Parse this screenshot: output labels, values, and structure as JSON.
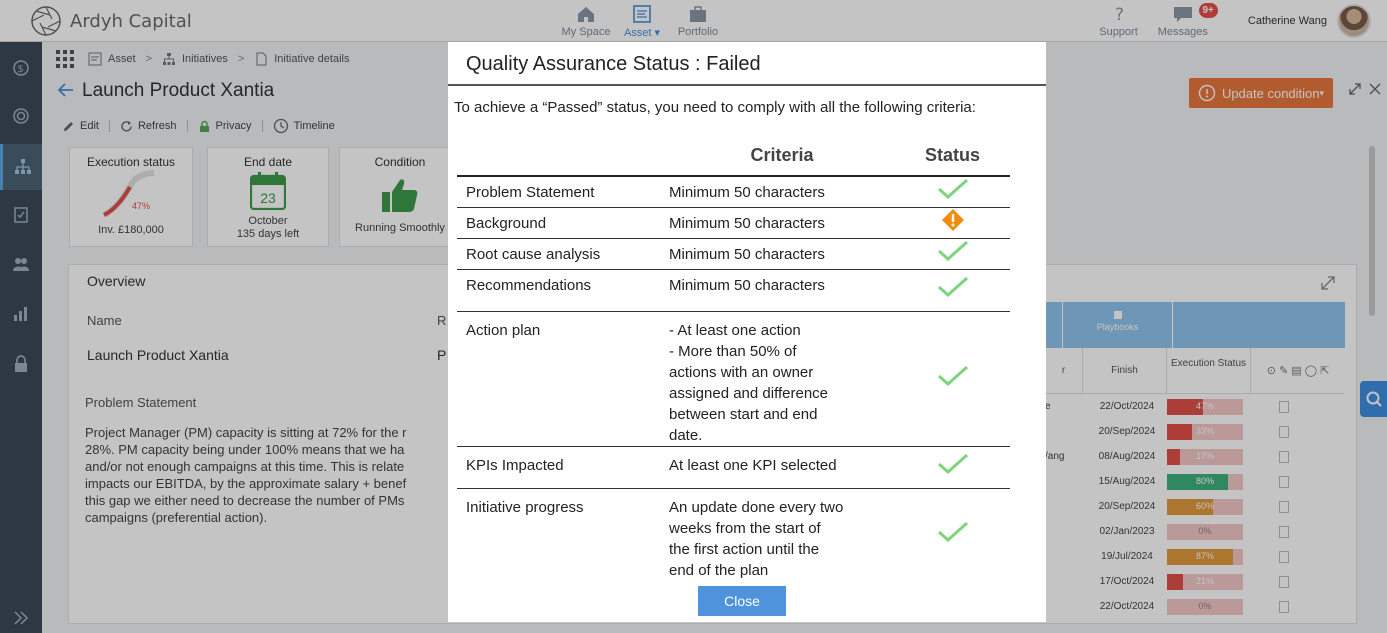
{
  "app": {
    "name": "Ardyh Capital",
    "nav": [
      {
        "label": "My Space",
        "icon": "home-icon"
      },
      {
        "label": "Asset",
        "icon": "asset-icon",
        "active": true
      },
      {
        "label": "Portfolio",
        "icon": "briefcase-icon"
      }
    ],
    "support_label": "Support",
    "messages_label": "Messages",
    "messages_badge": "9+",
    "user_name": "Catherine Wang"
  },
  "breadcrumb": [
    "Asset",
    "Initiatives",
    "Initiative details"
  ],
  "page": {
    "title": "Launch Product Xantia",
    "toolbar": {
      "edit": "Edit",
      "refresh": "Refresh",
      "privacy": "Privacy",
      "timeline": "Timeline"
    },
    "update_condition": "Update condition"
  },
  "kpis": {
    "execution": {
      "title": "Execution status",
      "pct": "47%",
      "sub": "Inv. £180,000"
    },
    "end_date": {
      "title": "End date",
      "day": "23",
      "month": "October",
      "sub": "135 days left"
    },
    "condition": {
      "title": "Condition",
      "sub": "Running Smoothly"
    }
  },
  "overview": {
    "title": "Overview",
    "name_label": "Name",
    "name_value": "Launch Product Xantia",
    "r_label": "R",
    "p_value": "P",
    "problem_title": "Problem Statement",
    "problem_body": "Project Manager (PM) capacity is sitting at 72% for the r\n28%. PM capacity being under 100% means that we ha\nand/or not enough campaigns at this time. This is relate\nimpacts our EBITDA, by the approximate salary + benef\nthis gap we either need to decrease the number of PMs\ncampaigns (preferential action)."
  },
  "side_table": {
    "header_label": "Playbooks",
    "col_finish": "Finish",
    "col_exec": "Execution Status",
    "col_r": "r",
    "rows": [
      {
        "c1": "e",
        "finish": "22/Oct/2024",
        "pct": "47%",
        "value": 0.47,
        "color": "#e0504a"
      },
      {
        "c1": "",
        "finish": "20/Sep/2024",
        "pct": "33%",
        "value": 0.33,
        "color": "#e0504a"
      },
      {
        "c1": "/ang",
        "finish": "08/Aug/2024",
        "pct": "17%",
        "value": 0.17,
        "color": "#e0504a"
      },
      {
        "c1": "",
        "finish": "15/Aug/2024",
        "pct": "80%",
        "value": 0.8,
        "color": "#3fb27f"
      },
      {
        "c1": "",
        "finish": "20/Sep/2024",
        "pct": "60%",
        "value": 0.6,
        "color": "#e09a3e"
      },
      {
        "c1": "",
        "finish": "02/Jan/2023",
        "pct": "0%",
        "value": 0.0,
        "color": "#e0504a"
      },
      {
        "c1": "",
        "finish": "19/Jul/2024",
        "pct": "87%",
        "value": 0.87,
        "color": "#e09a3e"
      },
      {
        "c1": "",
        "finish": "17/Oct/2024",
        "pct": "21%",
        "value": 0.21,
        "color": "#e0504a"
      },
      {
        "c1": "",
        "finish": "22/Oct/2024",
        "pct": "0%",
        "value": 0.0,
        "color": "#e0504a"
      }
    ]
  },
  "modal": {
    "title": "Quality Assurance Status : Failed",
    "intro": "To achieve a  “Passed” status,   you need to comply with all the following criteria:",
    "col_criteria": "Criteria",
    "col_status": "Status",
    "rows": [
      {
        "name": "Problem Statement",
        "criteria": "Minimum 50 characters",
        "status": "passed"
      },
      {
        "name": "Background",
        "criteria": "Minimum 50 characters",
        "status": "warning"
      },
      {
        "name": "Root cause analysis",
        "criteria": "Minimum 50 characters",
        "status": "passed"
      },
      {
        "name": "Recommendations",
        "criteria": "Minimum 50 characters",
        "status": "passed"
      },
      {
        "name": "Action plan",
        "criteria": "- At least one action\n- More than 50% of\nactions with an owner\nassigned and difference\nbetween start and end\ndate.",
        "status": "passed"
      },
      {
        "name": "KPIs Impacted",
        "criteria": "At least one KPI selected",
        "status": "passed"
      },
      {
        "name": "Initiative progress",
        "criteria": "An update done every two\nweeks from the start of\nthe first action until the\nend of the plan",
        "status": "passed"
      }
    ],
    "close_label": "Close"
  },
  "colors": {
    "accent": "#4e93db",
    "check": "#7ed47e",
    "warning": "#f28c0f",
    "update_btn": "#e8773d"
  }
}
